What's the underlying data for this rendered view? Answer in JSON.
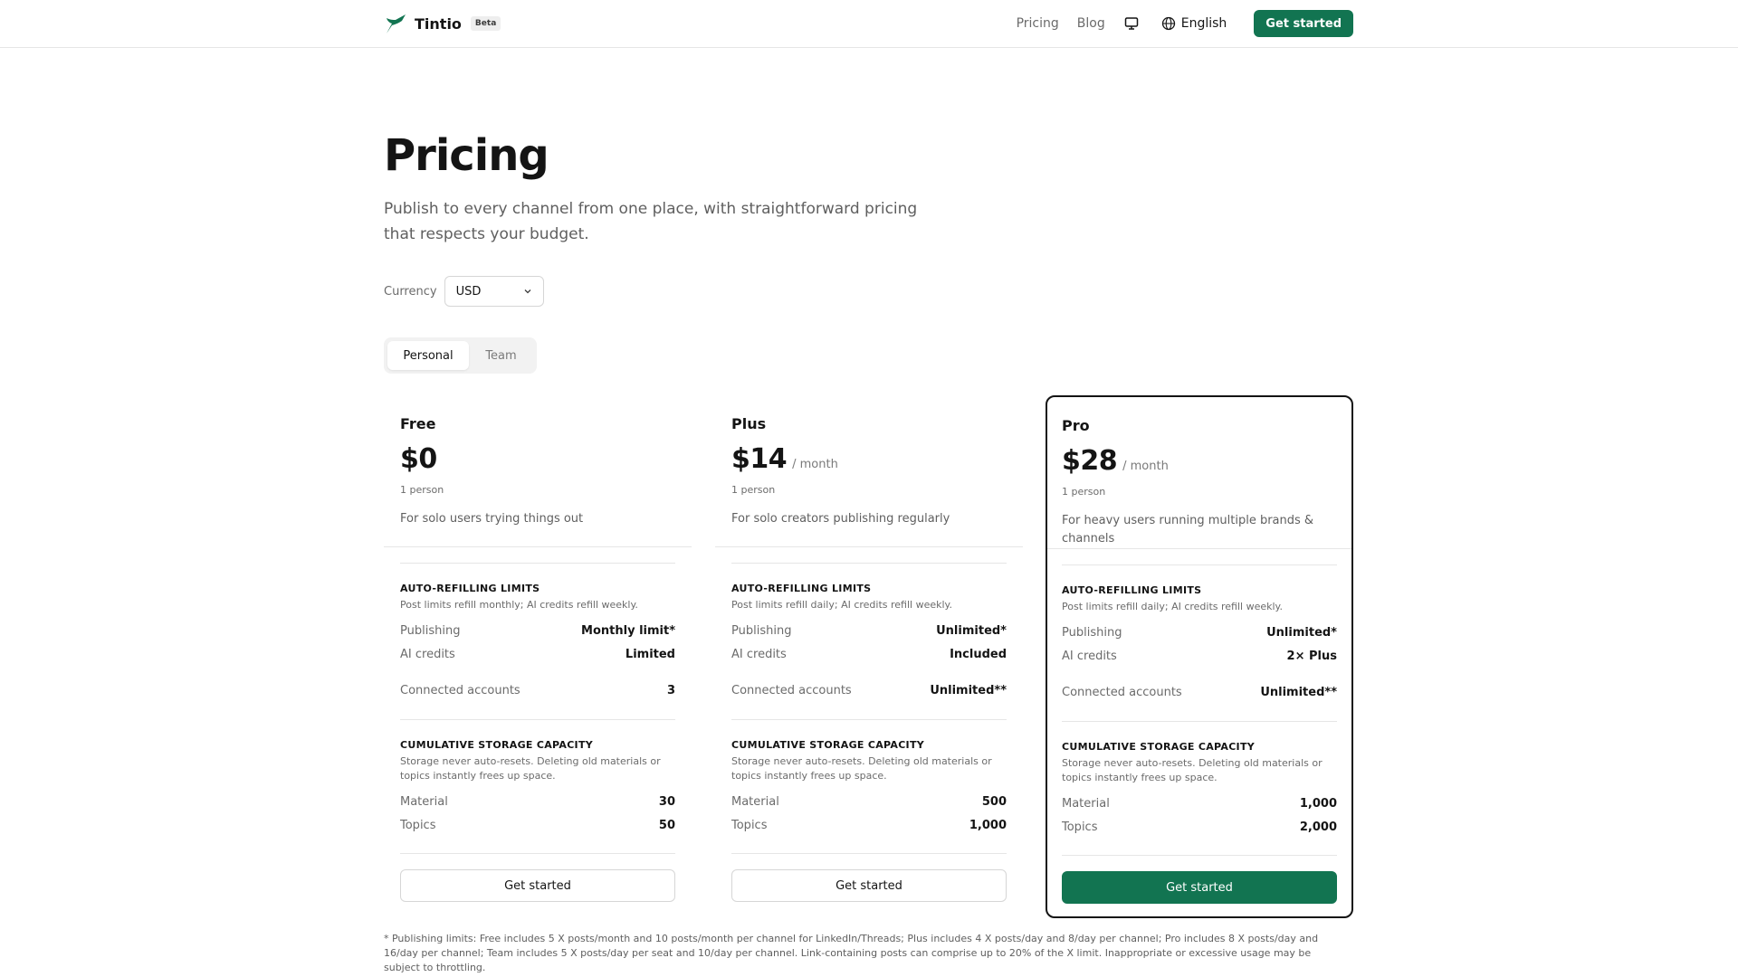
{
  "header": {
    "brand": "Tintio",
    "badge": "Beta",
    "nav": {
      "pricing": "Pricing",
      "blog": "Blog",
      "language": "English",
      "cta": "Get started"
    }
  },
  "hero": {
    "title": "Pricing",
    "subtitle": "Publish to every channel from one place, with straightforward pricing that respects your budget."
  },
  "currency": {
    "label": "Currency",
    "value": "USD"
  },
  "tabs": {
    "personal": "Personal",
    "team": "Team",
    "active": "Personal"
  },
  "plans": [
    {
      "name": "Free",
      "price": "$0",
      "period": "",
      "seats": "1 person",
      "description": "For solo users trying things out",
      "limits_title": "AUTO-REFILLING LIMITS",
      "limits_note": "Post limits refill monthly; AI credits refill weekly.",
      "publishing_label": "Publishing",
      "publishing": "Monthly limit*",
      "ai_label": "AI credits",
      "ai": "Limited",
      "accounts_label": "Connected accounts",
      "accounts": "3",
      "storage_title": "CUMULATIVE STORAGE CAPACITY",
      "storage_note": "Storage never auto-resets. Deleting old materials or topics instantly frees up space.",
      "material_label": "Material",
      "material": "30",
      "topics_label": "Topics",
      "topics": "50",
      "cta": "Get started"
    },
    {
      "name": "Plus",
      "price": "$14",
      "period": "/ month",
      "seats": "1 person",
      "description": "For solo creators publishing regularly",
      "limits_title": "AUTO-REFILLING LIMITS",
      "limits_note": "Post limits refill daily; AI credits refill weekly.",
      "publishing_label": "Publishing",
      "publishing": "Unlimited*",
      "ai_label": "AI credits",
      "ai": "Included",
      "accounts_label": "Connected accounts",
      "accounts": "Unlimited**",
      "storage_title": "CUMULATIVE STORAGE CAPACITY",
      "storage_note": "Storage never auto-resets. Deleting old materials or topics instantly frees up space.",
      "material_label": "Material",
      "material": "500",
      "topics_label": "Topics",
      "topics": "1,000",
      "cta": "Get started"
    },
    {
      "name": "Pro",
      "price": "$28",
      "period": "/ month",
      "seats": "1 person",
      "description": "For heavy users running multiple brands & channels",
      "limits_title": "AUTO-REFILLING LIMITS",
      "limits_note": "Post limits refill daily; AI credits refill weekly.",
      "publishing_label": "Publishing",
      "publishing": "Unlimited*",
      "ai_label": "AI credits",
      "ai": "2× Plus",
      "accounts_label": "Connected accounts",
      "accounts": "Unlimited**",
      "storage_title": "CUMULATIVE STORAGE CAPACITY",
      "storage_note": "Storage never auto-resets. Deleting old materials or topics instantly frees up space.",
      "material_label": "Material",
      "material": "1,000",
      "topics_label": "Topics",
      "topics": "2,000",
      "cta": "Get started"
    }
  ],
  "footnote": "* Publishing limits: Free includes 5 X posts/month and 10 posts/month per channel for LinkedIn/Threads; Plus includes 4 X posts/day and 8/day per channel; Pro includes 8 X posts/day and 16/day per channel; Team includes 5 X posts/day per seat and 10/day per channel. Link-containing posts can comprise up to 20% of the X limit. Inappropriate or excessive usage may be subject to throttling.",
  "colors": {
    "brand": "#127451",
    "text": "#141414",
    "muted": "#6b6b6b",
    "border": "#e6e6e6"
  },
  "icons": {
    "logo": "bird-logo-icon",
    "display": "monitor-icon",
    "language": "globe-icon",
    "select": "chevron-down-icon"
  }
}
